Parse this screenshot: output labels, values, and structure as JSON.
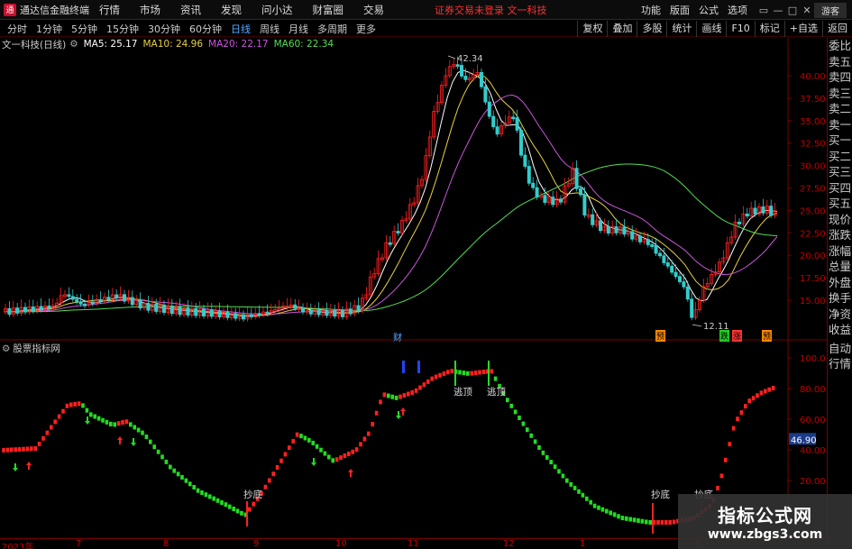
{
  "app": {
    "title": "通达信金融终端",
    "logo_text": "通",
    "menu": [
      "行情",
      "市场",
      "资讯",
      "发现",
      "问小达",
      "财富圈",
      "交易"
    ],
    "notice": "证券交易未登录  文一科技",
    "right_menu": [
      "功能",
      "版面",
      "公式",
      "选项"
    ],
    "guest": "游客",
    "window_buttons": [
      "▭",
      "—",
      "□",
      "✕"
    ]
  },
  "toolbar": {
    "periods": [
      "分时",
      "1分钟",
      "5分钟",
      "15分钟",
      "30分钟",
      "60分钟",
      "日线",
      "周线",
      "月线",
      "多周期",
      "更多"
    ],
    "active_period": "日线",
    "right_buttons": [
      "复权",
      "叠加",
      "多股",
      "统计",
      "画线",
      "F10",
      "标记",
      "+自选",
      "返回"
    ]
  },
  "stock": {
    "name": "文一科技(日线)",
    "ma": [
      {
        "label": "MA5: 25.17",
        "color": "#ffffff"
      },
      {
        "label": "MA10: 24.96",
        "color": "#e8d23a"
      },
      {
        "label": "MA20: 22.17",
        "color": "#cc55dd"
      },
      {
        "label": "MA60: 22.34",
        "color": "#55dd55"
      }
    ]
  },
  "quote_panel": {
    "items": [
      "委比",
      "卖五",
      "卖四",
      "卖三",
      "卖二",
      "卖一",
      "买一",
      "买二",
      "买三",
      "买四",
      "买五",
      "现价",
      "涨跌",
      "涨幅",
      "总量",
      "外盘",
      "换手",
      "净资",
      "收益",
      "自动",
      "行情"
    ]
  },
  "price_axis": [
    "40.00",
    "37.50",
    "35.00",
    "32.50",
    "30.00",
    "27.50",
    "25.00",
    "22.50",
    "20.00",
    "17.50",
    "15.00"
  ],
  "price_annotations": {
    "high": "42.34",
    "low": "12.11"
  },
  "event_marks": [
    {
      "text": "财",
      "color": "#55aaff"
    },
    {
      "text": "预",
      "color": "#ff8800"
    },
    {
      "text": "跌",
      "color": "#22cc22"
    },
    {
      "text": "涨",
      "color": "#ff3333"
    },
    {
      "text": "预",
      "color": "#ff8800"
    }
  ],
  "indicator": {
    "name": "股票指标网",
    "axis": [
      "100.0",
      "80.00",
      "60.00",
      "40.00",
      "20.00"
    ],
    "current_value": "46.90",
    "labels": [
      "抄底",
      "逃顶",
      "逃顶",
      "抄底",
      "抄底"
    ]
  },
  "dates": [
    "2023年",
    "7",
    "8",
    "9",
    "10",
    "11",
    "12",
    "1",
    "3"
  ],
  "watermark": {
    "title": "指标公式网",
    "url": "www.zbgs3.com"
  },
  "colors": {
    "up": "#ff2020",
    "down": "#22dd22",
    "axis": "#7a0000",
    "axis_text": "#c00000"
  }
}
